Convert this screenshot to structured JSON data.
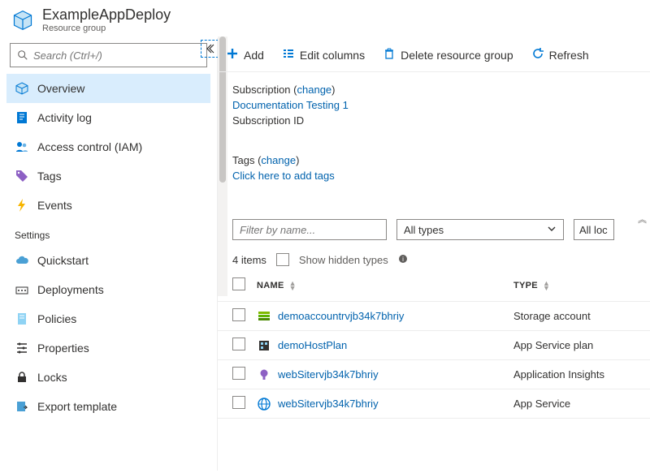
{
  "header": {
    "title": "ExampleAppDeploy",
    "subtitle": "Resource group"
  },
  "search": {
    "placeholder": "Search (Ctrl+/)"
  },
  "sidebar": {
    "items": [
      {
        "label": "Overview"
      },
      {
        "label": "Activity log"
      },
      {
        "label": "Access control (IAM)"
      },
      {
        "label": "Tags"
      },
      {
        "label": "Events"
      }
    ],
    "settings_heading": "Settings",
    "settings": [
      {
        "label": "Quickstart"
      },
      {
        "label": "Deployments"
      },
      {
        "label": "Policies"
      },
      {
        "label": "Properties"
      },
      {
        "label": "Locks"
      },
      {
        "label": "Export template"
      }
    ]
  },
  "toolbar": {
    "add": "Add",
    "edit_columns": "Edit columns",
    "delete": "Delete resource group",
    "refresh": "Refresh"
  },
  "info": {
    "subscription_label": "Subscription",
    "change_label": "change",
    "subscription_name": "Documentation Testing 1",
    "subscription_id_label": "Subscription ID",
    "tags_label": "Tags",
    "tags_add": "Click here to add tags"
  },
  "filters": {
    "filter_placeholder": "Filter by name...",
    "types_label": "All types",
    "locations_label": "All loc"
  },
  "list": {
    "count_text": "4 items",
    "hidden_label": "Show hidden types",
    "col_name": "NAME",
    "col_type": "TYPE",
    "rows": [
      {
        "name": "demoaccountrvjb34k7bhriy",
        "type": "Storage account"
      },
      {
        "name": "demoHostPlan",
        "type": "App Service plan"
      },
      {
        "name": "webSitervjb34k7bhriy",
        "type": "Application Insights"
      },
      {
        "name": "webSitervjb34k7bhriy",
        "type": "App Service"
      }
    ]
  }
}
